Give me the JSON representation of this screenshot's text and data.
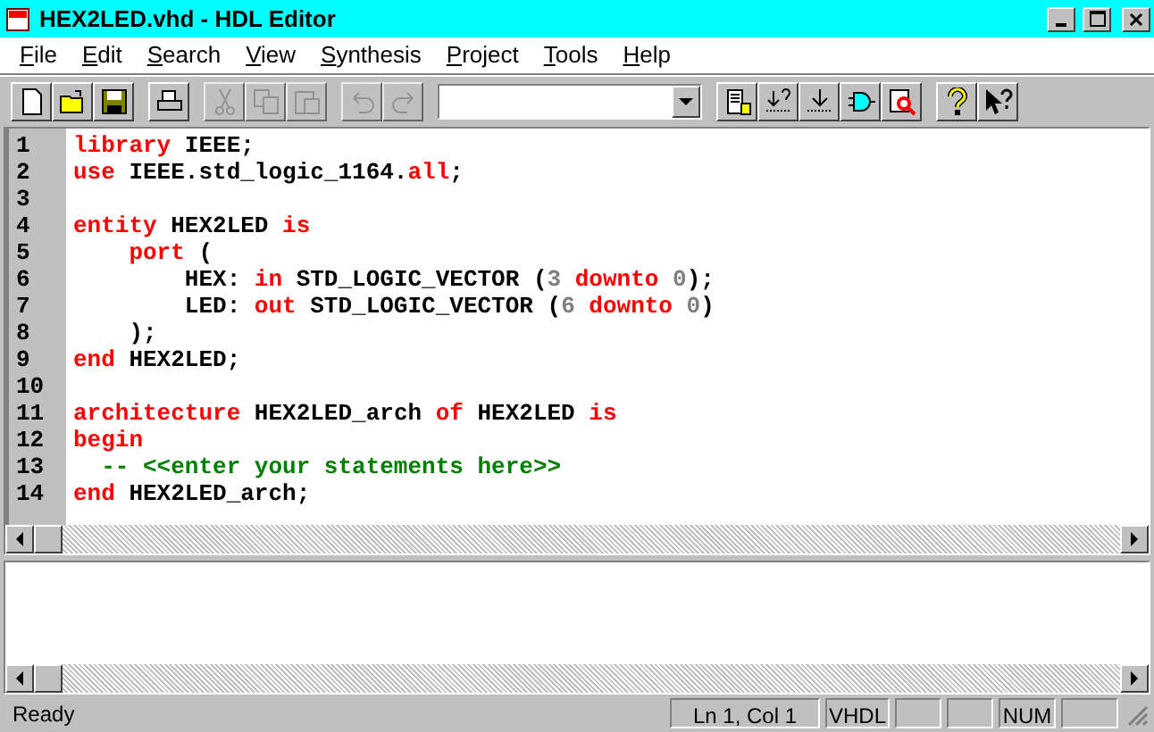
{
  "window": {
    "title": "HEX2LED.vhd - HDL Editor"
  },
  "menu": [
    "File",
    "Edit",
    "Search",
    "View",
    "Synthesis",
    "Project",
    "Tools",
    "Help"
  ],
  "toolbar": [
    {
      "kind": "new",
      "disabled": false
    },
    {
      "kind": "open",
      "disabled": false
    },
    {
      "kind": "save",
      "disabled": false
    },
    {
      "kind": "sep"
    },
    {
      "kind": "print",
      "disabled": false
    },
    {
      "kind": "sep"
    },
    {
      "kind": "cut",
      "disabled": true
    },
    {
      "kind": "copy",
      "disabled": true
    },
    {
      "kind": "paste",
      "disabled": true
    },
    {
      "kind": "sep"
    },
    {
      "kind": "undo",
      "disabled": true
    },
    {
      "kind": "redo",
      "disabled": true
    },
    {
      "kind": "sep"
    },
    {
      "kind": "combo"
    },
    {
      "kind": "sep"
    },
    {
      "kind": "doc",
      "disabled": false
    },
    {
      "kind": "check",
      "disabled": false
    },
    {
      "kind": "down",
      "disabled": false
    },
    {
      "kind": "gate",
      "disabled": false
    },
    {
      "kind": "zoom",
      "disabled": false
    },
    {
      "kind": "sep"
    },
    {
      "kind": "help",
      "disabled": false
    },
    {
      "kind": "whatsthis",
      "disabled": false
    }
  ],
  "code": [
    {
      "number": "1",
      "tokens": [
        {
          "kind": "keyword",
          "text": "library"
        },
        {
          "kind": "plain",
          "text": " IEEE;"
        }
      ]
    },
    {
      "number": "2",
      "tokens": [
        {
          "kind": "keyword",
          "text": "use"
        },
        {
          "kind": "plain",
          "text": " IEEE.std_logic_1164."
        },
        {
          "kind": "keyword",
          "text": "all"
        },
        {
          "kind": "plain",
          "text": ";"
        }
      ]
    },
    {
      "number": "3"
    },
    {
      "number": "4",
      "tokens": [
        {
          "kind": "keyword",
          "text": "entity"
        },
        {
          "kind": "plain",
          "text": " HEX2LED "
        },
        {
          "kind": "keyword",
          "text": "is"
        }
      ]
    },
    {
      "number": "5",
      "tokens": [
        {
          "kind": "keyword",
          "text": "    port"
        },
        {
          "kind": "plain",
          "text": " ("
        }
      ]
    },
    {
      "number": "6",
      "tokens": [
        {
          "kind": "plain",
          "text": "        HEX: "
        },
        {
          "kind": "keyword",
          "text": "in"
        },
        {
          "kind": "plain",
          "text": " STD_LOGIC_VECTOR ("
        },
        {
          "kind": "number",
          "text": "3"
        },
        {
          "kind": "keyword",
          "text": " downto "
        },
        {
          "kind": "number",
          "text": "0"
        },
        {
          "kind": "plain",
          "text": ");"
        }
      ]
    },
    {
      "number": "7",
      "tokens": [
        {
          "kind": "plain",
          "text": "        LED: "
        },
        {
          "kind": "keyword",
          "text": "out"
        },
        {
          "kind": "plain",
          "text": " STD_LOGIC_VECTOR ("
        },
        {
          "kind": "number",
          "text": "6"
        },
        {
          "kind": "keyword",
          "text": " downto "
        },
        {
          "kind": "number",
          "text": "0"
        },
        {
          "kind": "plain",
          "text": ")"
        }
      ]
    },
    {
      "number": "8",
      "tokens": [
        {
          "kind": "plain",
          "text": "    );"
        }
      ]
    },
    {
      "number": "9",
      "tokens": [
        {
          "kind": "keyword",
          "text": "end"
        },
        {
          "kind": "plain",
          "text": " HEX2LED;"
        }
      ]
    },
    {
      "number": "10"
    },
    {
      "number": "11",
      "tokens": [
        {
          "kind": "keyword",
          "text": "architecture"
        },
        {
          "kind": "plain",
          "text": " HEX2LED_arch "
        },
        {
          "kind": "keyword",
          "text": "of"
        },
        {
          "kind": "plain",
          "text": " HEX2LED "
        },
        {
          "kind": "keyword",
          "text": "is"
        }
      ]
    },
    {
      "number": "12",
      "tokens": [
        {
          "kind": "keyword",
          "text": "begin"
        }
      ]
    },
    {
      "number": "13",
      "tokens": [
        {
          "kind": "comment",
          "text": "  -- <<enter your statements here>>"
        }
      ]
    },
    {
      "number": "14",
      "tokens": [
        {
          "kind": "keyword",
          "text": "end"
        },
        {
          "kind": "plain",
          "text": " HEX2LED_arch;"
        }
      ]
    }
  ],
  "status_bar": {
    "message": "Ready",
    "panes": [
      "Ln 1, Col 1",
      "VHDL",
      "NUM"
    ]
  }
}
